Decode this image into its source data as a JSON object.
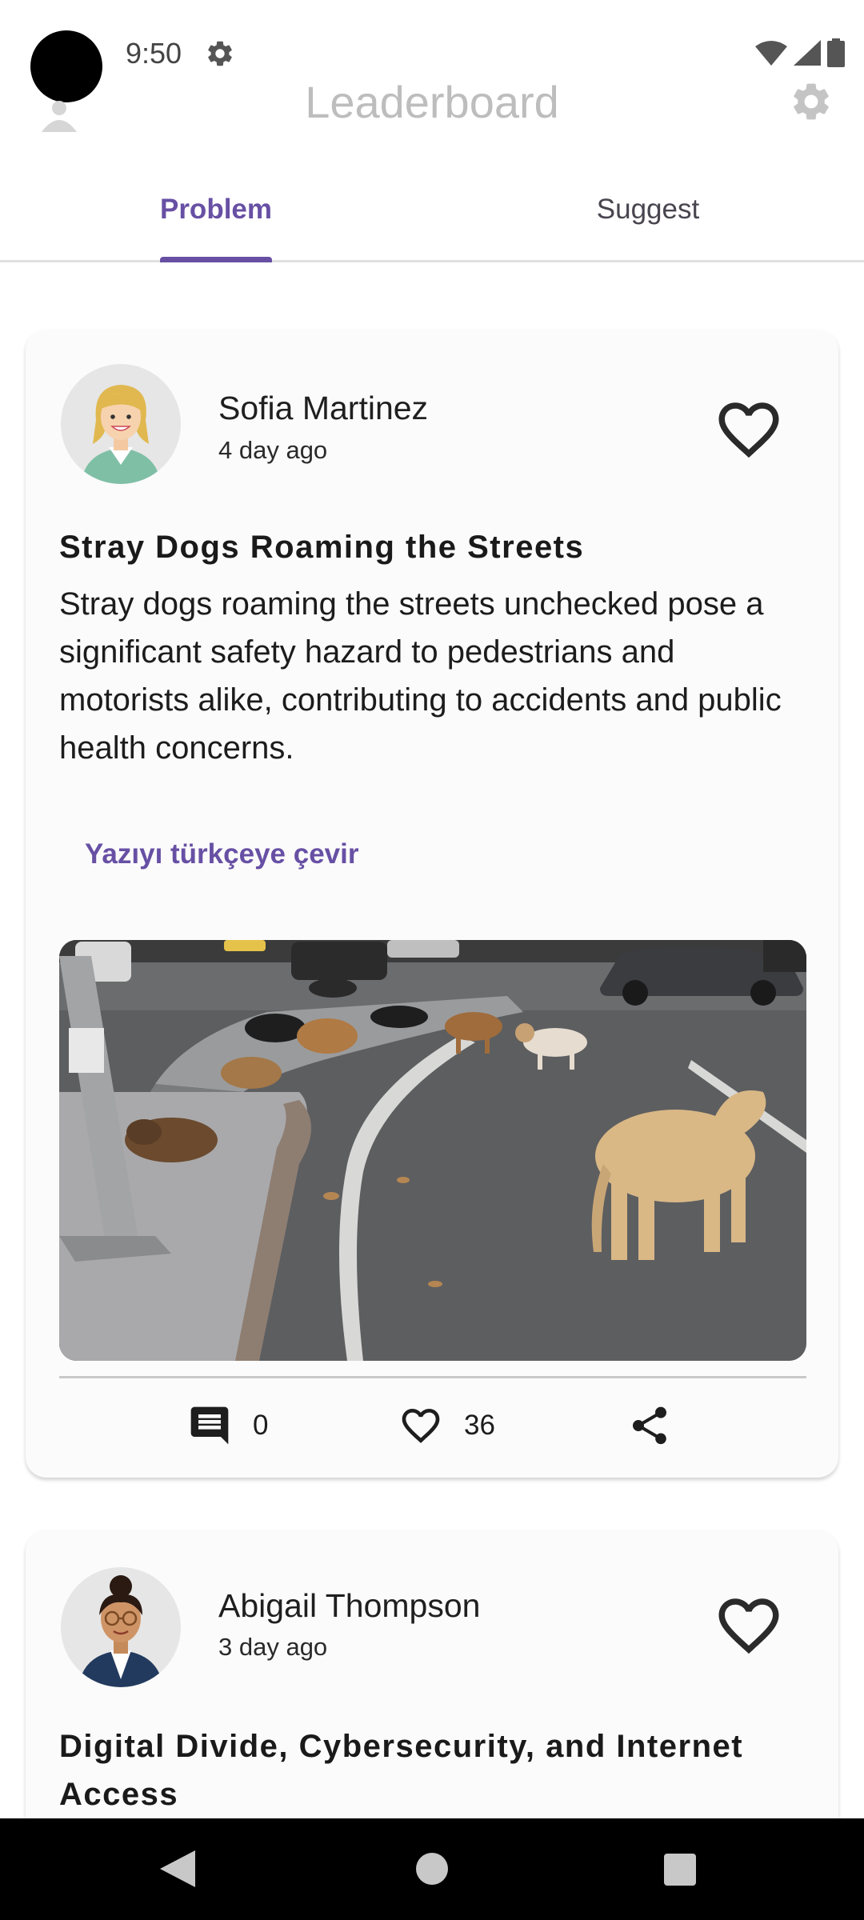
{
  "status_bar": {
    "time": "9:50"
  },
  "app_bar": {
    "title": "Leaderboard"
  },
  "tabs": [
    {
      "label": "Problem",
      "active": true
    },
    {
      "label": "Suggest",
      "active": false
    }
  ],
  "posts": [
    {
      "user_name": "Sofia Martinez",
      "time_ago": "4 day ago",
      "title": "Stray Dogs Roaming the Streets",
      "body": "Stray dogs roaming the streets unchecked pose a significant safety hazard to pedestrians and motorists alike, contributing to accidents and public health concerns.",
      "translate_label": "Yazıyı türkçeye çevir",
      "comment_count": "0",
      "like_count": "36"
    },
    {
      "user_name": "Abigail Thompson",
      "time_ago": "3 day ago",
      "title": "Digital Divide, Cybersecurity, and Internet Access"
    }
  ],
  "colors": {
    "accent": "#6750a4",
    "title_muted": "#bdbdbd",
    "card_bg": "#fbfbfb",
    "nav_bar": "#000000"
  },
  "icons": {
    "status": [
      "gear-icon",
      "wifi-icon",
      "signal-icon",
      "battery-icon"
    ],
    "app_bar": [
      "avatar-icon",
      "settings-icon"
    ],
    "post": [
      "heart-outline-icon",
      "comment-icon",
      "share-icon"
    ],
    "nav": [
      "back-icon",
      "home-icon",
      "recents-icon"
    ]
  }
}
